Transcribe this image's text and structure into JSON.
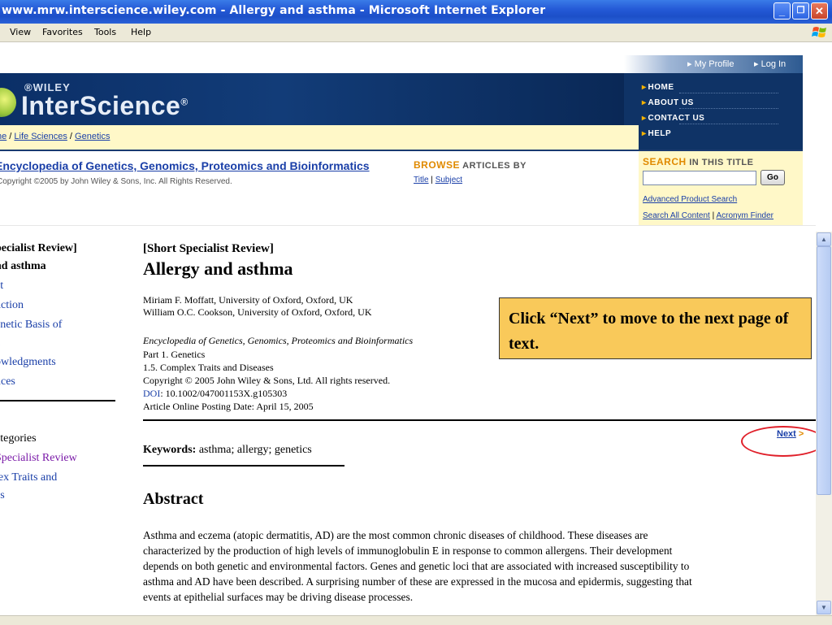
{
  "window": {
    "title": "www.mrw.interscience.wiley.com - Allergy and asthma - Microsoft Internet Explorer",
    "minimize": "_",
    "maximize": "❐",
    "close": "✕"
  },
  "menu": [
    "View",
    "Favorites",
    "Tools",
    "Help"
  ],
  "header": {
    "my_profile": "▸ My Profile",
    "log_in": "▸ Log In",
    "wiley": "®WILEY",
    "logo": "InterScience",
    "logo_mark": "®",
    "nav": [
      "HOME",
      "ABOUT US",
      "CONTACT US",
      "HELP"
    ],
    "breadcrumb": {
      "home": "ne",
      "life_sciences": "Life Sciences",
      "genetics": "Genetics",
      "sep": " / "
    }
  },
  "encyclopedia": {
    "title": "Encyclopedia of Genetics, Genomics, Proteomics and Bioinformatics",
    "copyright": "Copyright ©2005 by John Wiley & Sons, Inc. All Rights Reserved."
  },
  "browse": {
    "heading_accent": "BROWSE",
    "heading_rest": " ARTICLES BY",
    "title_link": "Title",
    "sep": " | ",
    "subject_link": "Subject"
  },
  "search": {
    "heading_accent": "SEARCH",
    "heading_rest": " IN THIS TITLE",
    "input_value": "",
    "go": "Go",
    "advanced": "Advanced Product Search",
    "all_content": "Search All Content",
    "sep": " | ",
    "acronym": "Acronym Finder"
  },
  "toc": {
    "items": [
      {
        "text": "pecialist Review]",
        "style": "bold"
      },
      {
        "text": "nd asthma",
        "style": "bold"
      },
      {
        "text": "ct",
        "style": "link"
      },
      {
        "text": "uction",
        "style": "link"
      },
      {
        "text": "enetic Basis of",
        "style": "link"
      },
      {
        "text": "a",
        "style": "link"
      },
      {
        "text": "owledgments",
        "style": "link"
      },
      {
        "text": "nces",
        "style": "link"
      }
    ],
    "categories_heading": "ategories",
    "categories": [
      {
        "text": "Specialist Review",
        "style": "visited"
      },
      {
        "text": "lex Traits and",
        "style": "link"
      },
      {
        "text": "es",
        "style": "link"
      }
    ]
  },
  "article": {
    "type": "[Short Specialist Review]",
    "title": "Allergy and asthma",
    "authors": [
      "Miriam F. Moffatt, University of Oxford, Oxford, UK",
      "William O.C. Cookson, University of Oxford, Oxford, UK"
    ],
    "source_title": "Encyclopedia of Genetics, Genomics, Proteomics and Bioinformatics",
    "part": "Part 1. Genetics",
    "section": "1.5.  Complex Traits and Diseases",
    "copyright": "Copyright © 2005 John Wiley & Sons, Ltd. All rights reserved.",
    "doi_label": "DOI",
    "doi_value": ": 10.1002/047001153X.g105303",
    "posting_date": "Article Online Posting Date: April 15, 2005",
    "next": "Next",
    "next_arrow": " >",
    "keywords_label": "Keywords:",
    "keywords": " asthma; allergy; genetics",
    "abstract_heading": "Abstract",
    "abstract_lines": [
      "Asthma and eczema (atopic dermatitis, AD) are the most common chronic diseases of childhood. These diseases are",
      "characterized by the production of high levels of immunoglobulin E in response to common allergens. Their development",
      "depends on both genetic and environmental factors. Genes and genetic loci that are associated with increased susceptibility to",
      "asthma and AD have been described. A surprising number of these are expressed in the mucosa and epidermis, suggesting that",
      "events at epithelial surfaces may be driving disease processes."
    ]
  },
  "callout": {
    "text": "Click “Next” to move to the next page of text."
  },
  "colors": {
    "link": "#1a3fa8",
    "visited": "#7a1aa8",
    "banner": "#0f3366",
    "accent": "#e08a00",
    "callout_bg": "#f9c95a",
    "highlight": "#e0202a"
  }
}
